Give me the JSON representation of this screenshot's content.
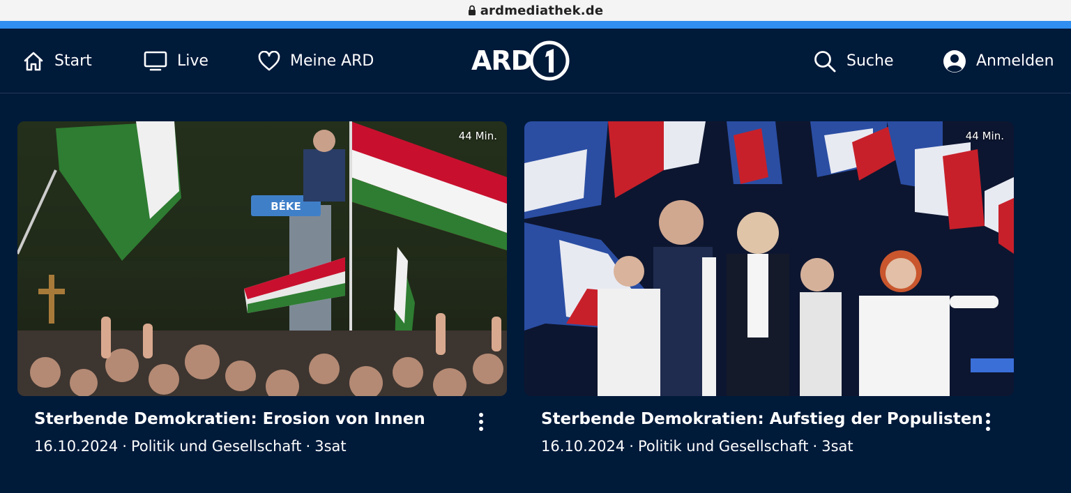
{
  "browser": {
    "url": "ardmediathek.de",
    "progress_color": "#2f8ef0"
  },
  "header": {
    "nav": [
      {
        "label": "Start",
        "icon": "home-icon"
      },
      {
        "label": "Live",
        "icon": "tv-icon"
      },
      {
        "label": "Meine ARD",
        "icon": "heart-icon"
      }
    ],
    "logo": {
      "text": "ARD",
      "icon": "ard-one-logo"
    },
    "search": {
      "label": "Suche",
      "icon": "search-icon"
    },
    "login": {
      "label": "Anmelden",
      "icon": "user-icon"
    }
  },
  "cards": [
    {
      "title": "Sterbende Demokratien: Erosion von Innen",
      "duration": "44 Min.",
      "date": "16.10.2024",
      "category": "Politik und Gesellschaft",
      "channel": "3sat",
      "separator": "·",
      "image_text": "BÉKE",
      "image": "rally-hungarian-flags"
    },
    {
      "title": "Sterbende Demokratien: Aufstieg der Populisten",
      "duration": "44 Min.",
      "date": "16.10.2024",
      "category": "Politik und Gesellschaft",
      "channel": "3sat",
      "separator": "·",
      "image": "rally-french-flags"
    }
  ],
  "colors": {
    "background": "#001a3a",
    "text": "#ffffff",
    "accent": "#2f8ef0"
  }
}
